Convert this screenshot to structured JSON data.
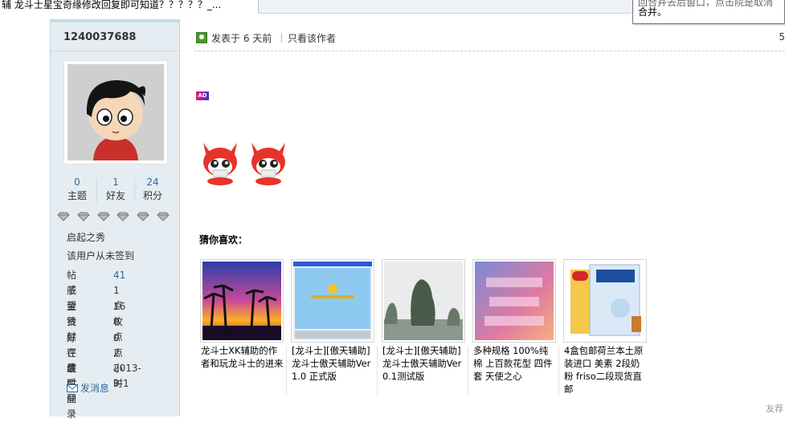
{
  "browser": {
    "tab_title": "辅 龙斗士星宝奇缘修改回复即可知道？？？？？_...",
    "tooltip_line1": "回合并去后窗口，点击院是取消",
    "tooltip_line2": "合并。"
  },
  "author": {
    "name": "1240037688",
    "stats": [
      {
        "value": "0",
        "label": "主题"
      },
      {
        "value": "1",
        "label": "好友"
      },
      {
        "value": "24",
        "label": "积分"
      }
    ],
    "diamond_count": 6,
    "group_title": "启起之秀",
    "sign_note": "该用户从未签到",
    "info": [
      {
        "key": "帖子",
        "value": "41"
      },
      {
        "key": "威望",
        "value": "1 点"
      },
      {
        "key": "金钱",
        "value": "16 枚"
      },
      {
        "key": "贡献",
        "value": "0 点"
      },
      {
        "key": "好评度",
        "value": "0 点"
      },
      {
        "key": "在线时间",
        "value": "2 小时"
      },
      {
        "key": "最后登录",
        "value": "2013-9-1"
      }
    ],
    "send_message": "发消息"
  },
  "post": {
    "posted_label": "发表于 6 天前",
    "only_author": "只看该作者",
    "floor": "5",
    "ad_label": "AD"
  },
  "recommend": {
    "title": "猜你喜欢：",
    "items": [
      {
        "caption": "龙斗士XK辅助的作者和玩龙斗士的进来"
      },
      {
        "caption": "[龙斗士][傲天辅助]龙斗士傲天辅助Ver1.0 正式版"
      },
      {
        "caption": "[龙斗士][傲天辅助]龙斗士傲天辅助Ver0.1测试版"
      },
      {
        "caption": "多种规格 100%纯棉 上百款花型 四件套 天使之心"
      },
      {
        "caption": "4盒包邮荷兰本土原装进口 美素 2段奶粉 friso二段现货直邮"
      }
    ]
  },
  "footer": {
    "corner_text": "友荐"
  },
  "colors": {
    "link": "#336699",
    "panel_bg": "#e5edf2",
    "panel_border": "#c2d5e3"
  }
}
